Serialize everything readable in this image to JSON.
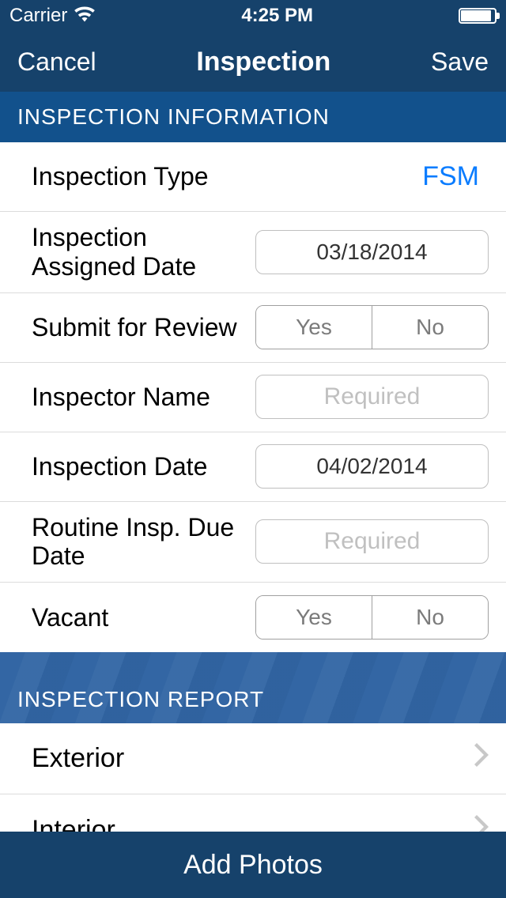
{
  "status": {
    "carrier": "Carrier",
    "time": "4:25 PM"
  },
  "nav": {
    "cancel": "Cancel",
    "title": "Inspection",
    "save": "Save"
  },
  "sections": {
    "info_header": "INSPECTION INFORMATION",
    "report_header": "INSPECTION REPORT"
  },
  "info": {
    "type_label": "Inspection Type",
    "type_value": "FSM",
    "assigned_date_label": "Inspection Assigned Date",
    "assigned_date_value": "03/18/2014",
    "submit_review_label": "Submit for Review",
    "inspector_name_label": "Inspector Name",
    "inspector_name_placeholder": "Required",
    "inspection_date_label": "Inspection Date",
    "inspection_date_value": "04/02/2014",
    "routine_due_label": "Routine Insp. Due Date",
    "routine_due_placeholder": "Required",
    "vacant_label": "Vacant",
    "yes": "Yes",
    "no": "No"
  },
  "report": {
    "items": [
      "Exterior",
      "Interior"
    ]
  },
  "footer": {
    "add_photos": "Add Photos"
  }
}
